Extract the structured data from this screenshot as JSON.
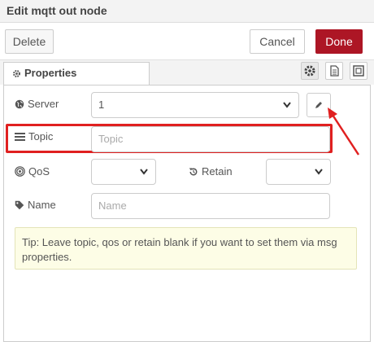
{
  "window": {
    "title": "Edit mqtt out node"
  },
  "toolbar": {
    "delete_label": "Delete",
    "cancel_label": "Cancel",
    "done_label": "Done"
  },
  "tabs": {
    "properties_label": "Properties"
  },
  "form": {
    "server_label": "Server",
    "server_value": "1",
    "topic_label": "Topic",
    "topic_placeholder": "Topic",
    "qos_label": "QoS",
    "qos_value": "",
    "retain_label": "Retain",
    "retain_value": "",
    "name_label": "Name",
    "name_placeholder": "Name"
  },
  "tip": {
    "text": "Tip: Leave topic, qos or retain blank if you want to set them via msg properties."
  },
  "colors": {
    "done_bg": "#ad1625",
    "highlight": "#e02020",
    "tip_bg": "#fdfde6"
  },
  "icons": [
    "gear-icon",
    "document-icon",
    "frame-icon",
    "globe-icon",
    "pencil-icon",
    "list-icon",
    "bullseye-icon",
    "history-icon",
    "tag-icon",
    "chevron-down-icon"
  ]
}
